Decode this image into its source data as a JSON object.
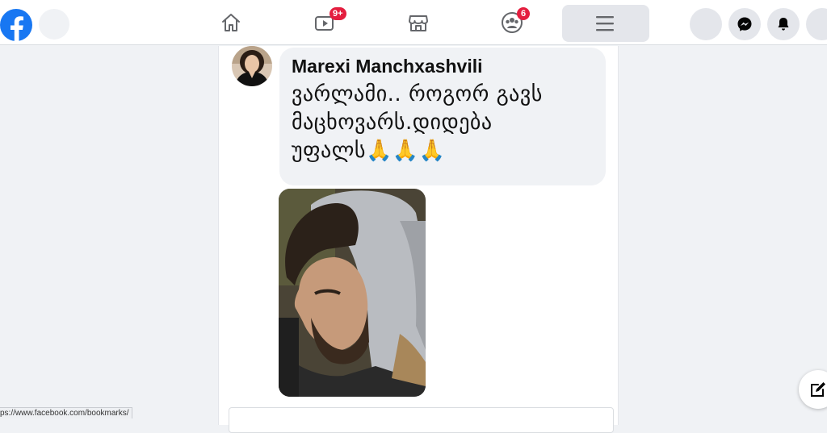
{
  "topbar": {
    "notifications": {
      "watch_badge": "9+",
      "groups_badge": "6"
    },
    "icons": [
      "facebook-logo",
      "home-icon",
      "watch-icon",
      "marketplace-icon",
      "groups-icon",
      "menu-icon",
      "messenger-icon",
      "notifications-icon"
    ]
  },
  "post": {
    "comment": {
      "author": "Marexi Manchxashvili",
      "lines": [
        "ვარლამი.. როგორ გავს",
        "მაცხოვარს.დიდება",
        "უფალს🙏🙏🙏"
      ]
    }
  },
  "status_bar": {
    "url": "ps://www.facebook.com/bookmarks/"
  },
  "colors": {
    "brand": "#1877f2",
    "badge": "#e41e3f",
    "bubble": "#f0f2f5"
  }
}
